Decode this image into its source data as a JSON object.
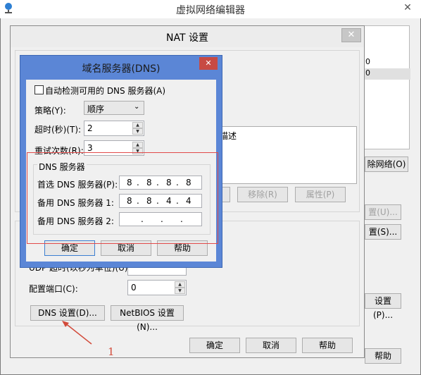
{
  "outer_window": {
    "title": "虚拟网络编辑器",
    "close_glyph": "✕",
    "right_panel_rows": [
      "0",
      "0"
    ],
    "buttons": {
      "remove_network": "除网络(O)",
      "settings_u": "置(U)...",
      "settings_s": "置(S)...",
      "settings_p": "设置(P)...",
      "help": "帮助"
    }
  },
  "nat": {
    "title": "NAT 设置",
    "close_glyph": "✕",
    "list_header": "描述",
    "buttons": {
      "add": "",
      "remove": "移除(R)",
      "properties": "属性(P)"
    },
    "udp_label_partial": "UDP 超时(以秒为单位)(U):",
    "config_port_label": "配置端口(C):",
    "config_port_value": "0",
    "dns_settings": "DNS 设置(D)...",
    "netbios_settings": "NetBIOS 设置(N)...",
    "ok": "确定",
    "cancel": "取消",
    "help": "帮助"
  },
  "dns": {
    "title": "域名服务器(DNS)",
    "close_glyph": "✕",
    "auto_detect": "自动检测可用的 DNS 服务器(A)",
    "policy_label": "策略(Y):",
    "policy_value": "顺序",
    "timeout_label": "超时(秒)(T):",
    "timeout_value": "2",
    "retries_label": "重试次数(R):",
    "retries_value": "3",
    "group_label": "DNS 服务器",
    "preferred_label": "首选 DNS 服务器(P):",
    "preferred": [
      "8",
      "8",
      "8",
      "8"
    ],
    "alt1_label": "备用 DNS 服务器 1:",
    "alt1": [
      "8",
      "8",
      "4",
      "4"
    ],
    "alt2_label": "备用 DNS 服务器 2:",
    "alt2": [
      ".",
      ".",
      "."
    ],
    "ok": "确定",
    "cancel": "取消",
    "help": "帮助"
  },
  "annotation_number": "1"
}
